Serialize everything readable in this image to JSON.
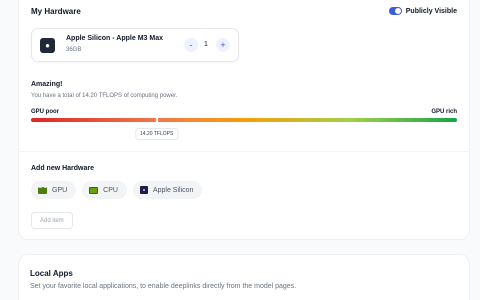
{
  "theme": {
    "accent": "#4f46e5",
    "toggle_on": "#3b5bdb",
    "bar_poor": "#dc2626",
    "bar_rich": "#16a34a"
  },
  "hardware": {
    "title": "My Hardware",
    "visibility": {
      "label": "Publicly Visible",
      "enabled": true
    },
    "device": {
      "icon": "apple-icon",
      "name": "Apple Silicon - Apple M3 Max",
      "memory": "36GB",
      "minus": "-",
      "quantity": "1",
      "plus": "+"
    },
    "summary": {
      "title": "Amazing!",
      "text": "You have a total of 14.20 TFLOPS of computing power.",
      "scale_min": "GPU poor",
      "scale_max": "GPU rich",
      "value_label": "14.20 TFLOPS",
      "level": 0.295
    },
    "add_title": "Add new Hardware",
    "options": [
      {
        "label": "GPU",
        "icon": "gpu-icon"
      },
      {
        "label": "CPU",
        "icon": "cpu-icon"
      },
      {
        "label": "Apple Silicon",
        "icon": "apple-silicon-icon"
      }
    ],
    "add_item": "Add item"
  },
  "local_apps": {
    "title": "Local Apps",
    "description": "Set your favorite local applications, to enable deeplinks directly from the model pages."
  }
}
